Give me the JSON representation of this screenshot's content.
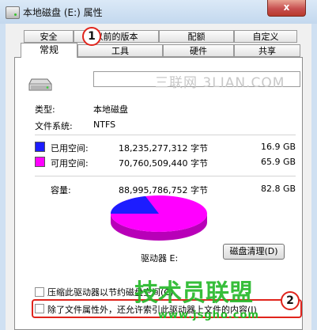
{
  "window": {
    "title": "本地磁盘 (E:) 属性",
    "close_label": "x"
  },
  "tabs": {
    "row1": [
      "安全",
      "以前的版本",
      "配额",
      "自定义"
    ],
    "row2": [
      "常规",
      "工具",
      "硬件",
      "共享"
    ],
    "active": "常规"
  },
  "general": {
    "type_label": "类型:",
    "type_value": "本地磁盘",
    "fs_label": "文件系统:",
    "fs_value": "NTFS",
    "used": {
      "label": "已用空间:",
      "bytes": "18,235,277,312 字节",
      "gb": "16.9 GB",
      "color": "#1d1dff"
    },
    "free": {
      "label": "可用空间:",
      "bytes": "70,760,509,440 字节",
      "gb": "65.9 GB",
      "color": "#ff00ff"
    },
    "capacity": {
      "label": "容量:",
      "bytes": "88,995,786,752 字节",
      "gb": "82.8 GB"
    },
    "used_fraction": 0.205,
    "drive_label": "驱动器 E:",
    "cleanup_button": "磁盘清理(D)",
    "compress_checkbox": "压缩此驱动器以节约磁盘空间(C)",
    "index_checkbox": "除了文件属性外，还允许索引此驱动器上文件的内容(I)"
  },
  "annotations": {
    "step1": "1",
    "step2": "2"
  },
  "watermarks": {
    "top": "三联网 3LIAN.COM",
    "middle": "技术员联盟",
    "bottom": "www.jsgho.com"
  }
}
